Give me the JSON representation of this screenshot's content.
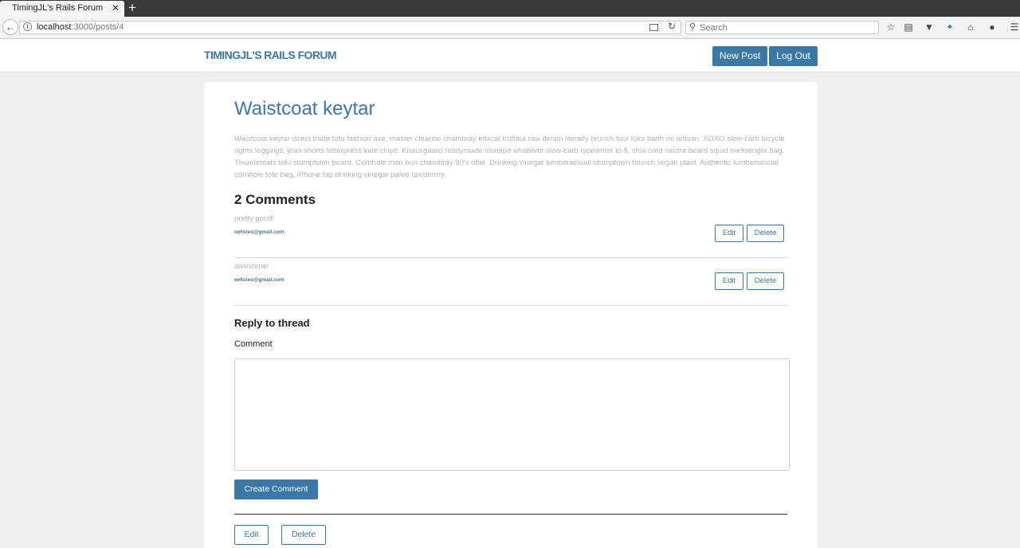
{
  "browser": {
    "tab_title": "TimingJL's Rails Forum",
    "tab_close": "✕",
    "new_tab": "+",
    "url_host": "localhost",
    "url_path": ":3000/posts/4",
    "search_placeholder": "Search"
  },
  "header": {
    "brand": "TIMINGJL'S RAILS FORUM",
    "new_post_label": "New Post",
    "log_out_label": "Log Out"
  },
  "post": {
    "title": "Waistcoat keytar",
    "body": "Waistcoat keytar direct trade tofu fashion axe, master cleanse chambray ethical truffaut raw denim literally brunch four loko banh mi artisan. XOXO slow-carb bicycle rights leggings, jean shorts letterpress kale chips. Knausgaard readymade mixtape whatever slow-carb typewriter lo-fi, chia cred neutra beard squid messenger bag. Thundercats tofu stumptown beard. Cornhole man bun chambray 90's offal. Drinking vinegar lumbersexual stumptown brunch vegan plaid. Authentic lumbersexual cornhole tote bag, iPhone fap drinking vinegar paleo taxidermy."
  },
  "comments": {
    "heading": "2 Comments",
    "items": [
      {
        "text": "pretty good!",
        "author": "eefozeo@gmail.com",
        "edit_label": "Edit",
        "delete_label": "Delete"
      },
      {
        "text": "awesome!",
        "author": "eefozeo@gmail.com",
        "edit_label": "Edit",
        "delete_label": "Delete"
      }
    ]
  },
  "reply": {
    "heading": "Reply to thread",
    "comment_label": "Comment",
    "comment_value": "",
    "submit_label": "Create Comment"
  },
  "post_actions": {
    "edit_label": "Edit",
    "delete_label": "Delete"
  }
}
